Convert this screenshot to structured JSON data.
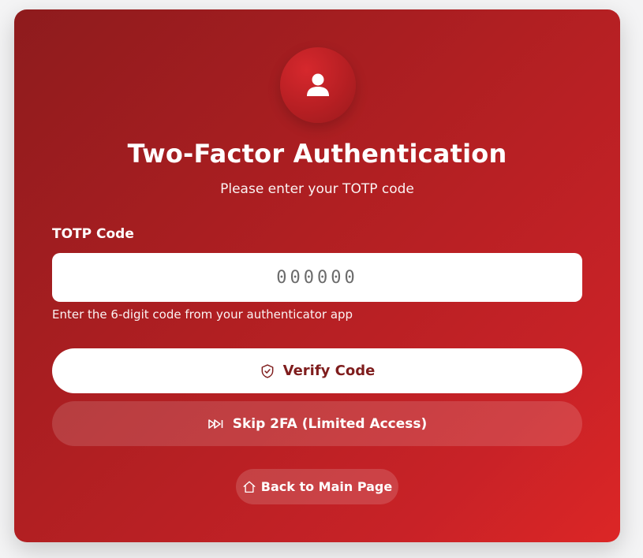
{
  "header": {
    "avatar_icon": "user-icon",
    "title": "Two-Factor Authentication",
    "subtitle": "Please enter your TOTP code"
  },
  "form": {
    "code_label": "TOTP Code",
    "code_placeholder": "000000",
    "code_value": "",
    "help_text": "Enter the 6-digit code from your authenticator app"
  },
  "actions": {
    "verify_label": "Verify Code",
    "verify_icon": "shield-check-icon",
    "skip_label": "Skip 2FA (Limited Access)",
    "skip_icon": "fast-forward-icon",
    "back_label": "Back to Main Page",
    "back_icon": "home-icon"
  },
  "colors": {
    "card_gradient_start": "#8e1b1d",
    "card_gradient_end": "#dc2626",
    "verify_text": "#7f1d1d"
  }
}
